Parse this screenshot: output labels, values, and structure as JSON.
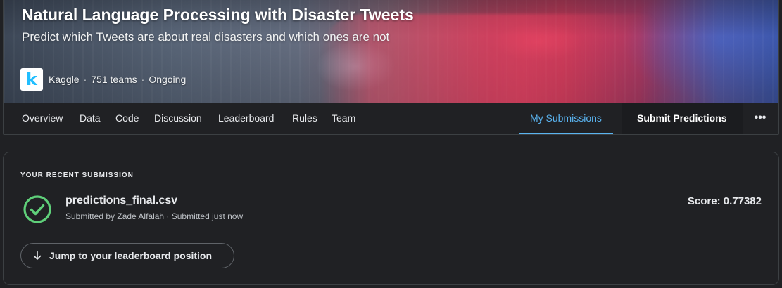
{
  "competition": {
    "title": "Natural Language Processing with Disaster Tweets",
    "subtitle": "Predict which Tweets are about real disasters and which ones are not",
    "host_logo_letter": "k",
    "host": "Kaggle",
    "teams": "751 teams",
    "status": "Ongoing"
  },
  "tabs": {
    "overview": "Overview",
    "data": "Data",
    "code": "Code",
    "discussion": "Discussion",
    "leaderboard": "Leaderboard",
    "rules": "Rules",
    "team": "Team",
    "my_submissions": "My Submissions",
    "active": "my_submissions"
  },
  "actions": {
    "submit_predictions": "Submit Predictions",
    "more_glyph": "•••"
  },
  "submission": {
    "heading": "YOUR RECENT SUBMISSION",
    "status_icon": "check-circle-icon",
    "file_name": "predictions_final.csv",
    "meta": "Submitted by Zade Alfalah · Submitted just now",
    "score": "Score: 0.77382",
    "jump_label": "Jump to your leaderboard position"
  },
  "colors": {
    "accent": "#5ab4f0",
    "success": "#5fd07a",
    "background": "#202124",
    "border": "#3c4043"
  }
}
